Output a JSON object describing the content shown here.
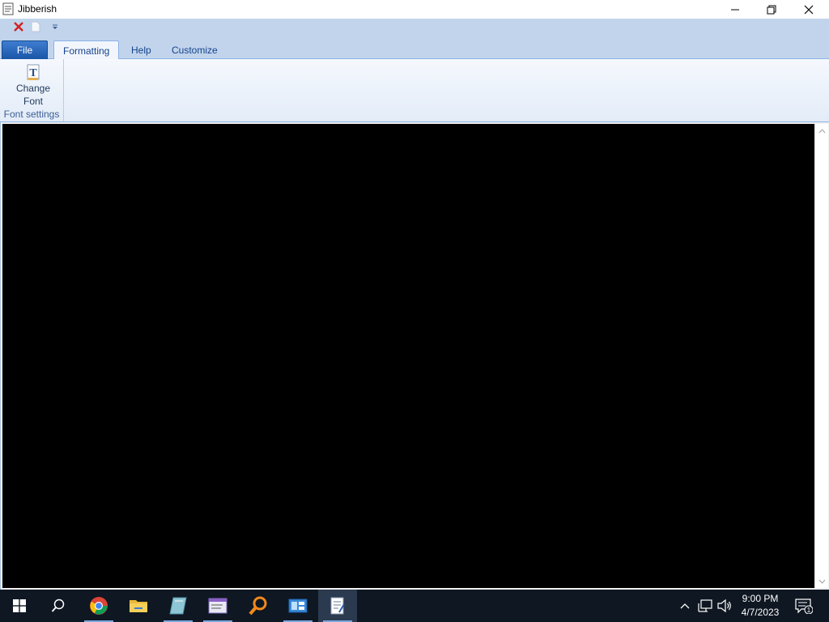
{
  "window": {
    "title": "Jibberish",
    "controls": {
      "minimize": "minimize",
      "maximize": "restore",
      "close": "close"
    }
  },
  "quick_access": [
    {
      "name": "close-document-icon"
    },
    {
      "name": "new-document-icon"
    },
    {
      "name": "customize-quick-access-icon"
    }
  ],
  "ribbon": {
    "file_tab": "File",
    "tabs": [
      {
        "label": "Formatting",
        "active": true
      },
      {
        "label": "Help",
        "active": false
      },
      {
        "label": "Customize",
        "active": false
      }
    ],
    "groups": [
      {
        "label": "Font settings",
        "buttons": [
          {
            "label_line1": "Change",
            "label_line2": "Font",
            "icon": "font-icon"
          }
        ]
      }
    ]
  },
  "editor": {
    "value": "",
    "background": "#000000",
    "foreground": "#ffffff"
  },
  "taskbar": {
    "apps": [
      {
        "name": "start-icon"
      },
      {
        "name": "search-icon"
      },
      {
        "name": "chrome-icon"
      },
      {
        "name": "file-explorer-icon"
      },
      {
        "name": "notebook-app-icon"
      },
      {
        "name": "card-app-icon"
      },
      {
        "name": "magnifier-app-icon"
      },
      {
        "name": "control-panel-icon"
      },
      {
        "name": "jibberish-app-icon"
      }
    ],
    "tray": {
      "time": "9:00 PM",
      "date": "4/7/2023",
      "notification_count": "1"
    }
  },
  "colors": {
    "ribbon_blue": "#c1d4ec",
    "file_tab": "#1a56a8",
    "taskbar": "#0f1722",
    "editor_bg": "#000000"
  }
}
